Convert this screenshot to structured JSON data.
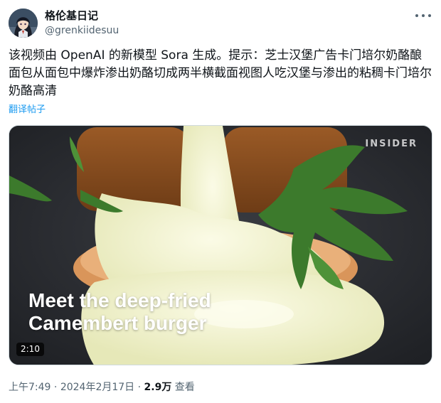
{
  "author": {
    "display_name": "格伦基日记",
    "handle": "@grenkiidesuu",
    "avatar_icon": "anime-avatar"
  },
  "post": {
    "text": "该视频由 OpenAI 的新模型 Sora 生成。提示：芝士汉堡广告卡门培尔奶酪酿面包从面包中爆炸渗出奶酪切成两半横截面视图人吃汉堡与渗出的粘稠卡门培尔奶酪高清",
    "translate_label": "翻译帖子"
  },
  "media": {
    "watermark": "INSIDER",
    "caption_line1": "Meet the deep-fried",
    "caption_line2": "Camembert burger",
    "duration": "2:10"
  },
  "meta": {
    "time": "上午7:49",
    "separator1": " · ",
    "date": "2024年2月17日",
    "separator2": " · ",
    "views": "2.9万",
    "views_label": " 查看"
  },
  "colors": {
    "link": "#1d9bf0",
    "secondary_text": "#536471",
    "primary_text": "#0f1419"
  }
}
